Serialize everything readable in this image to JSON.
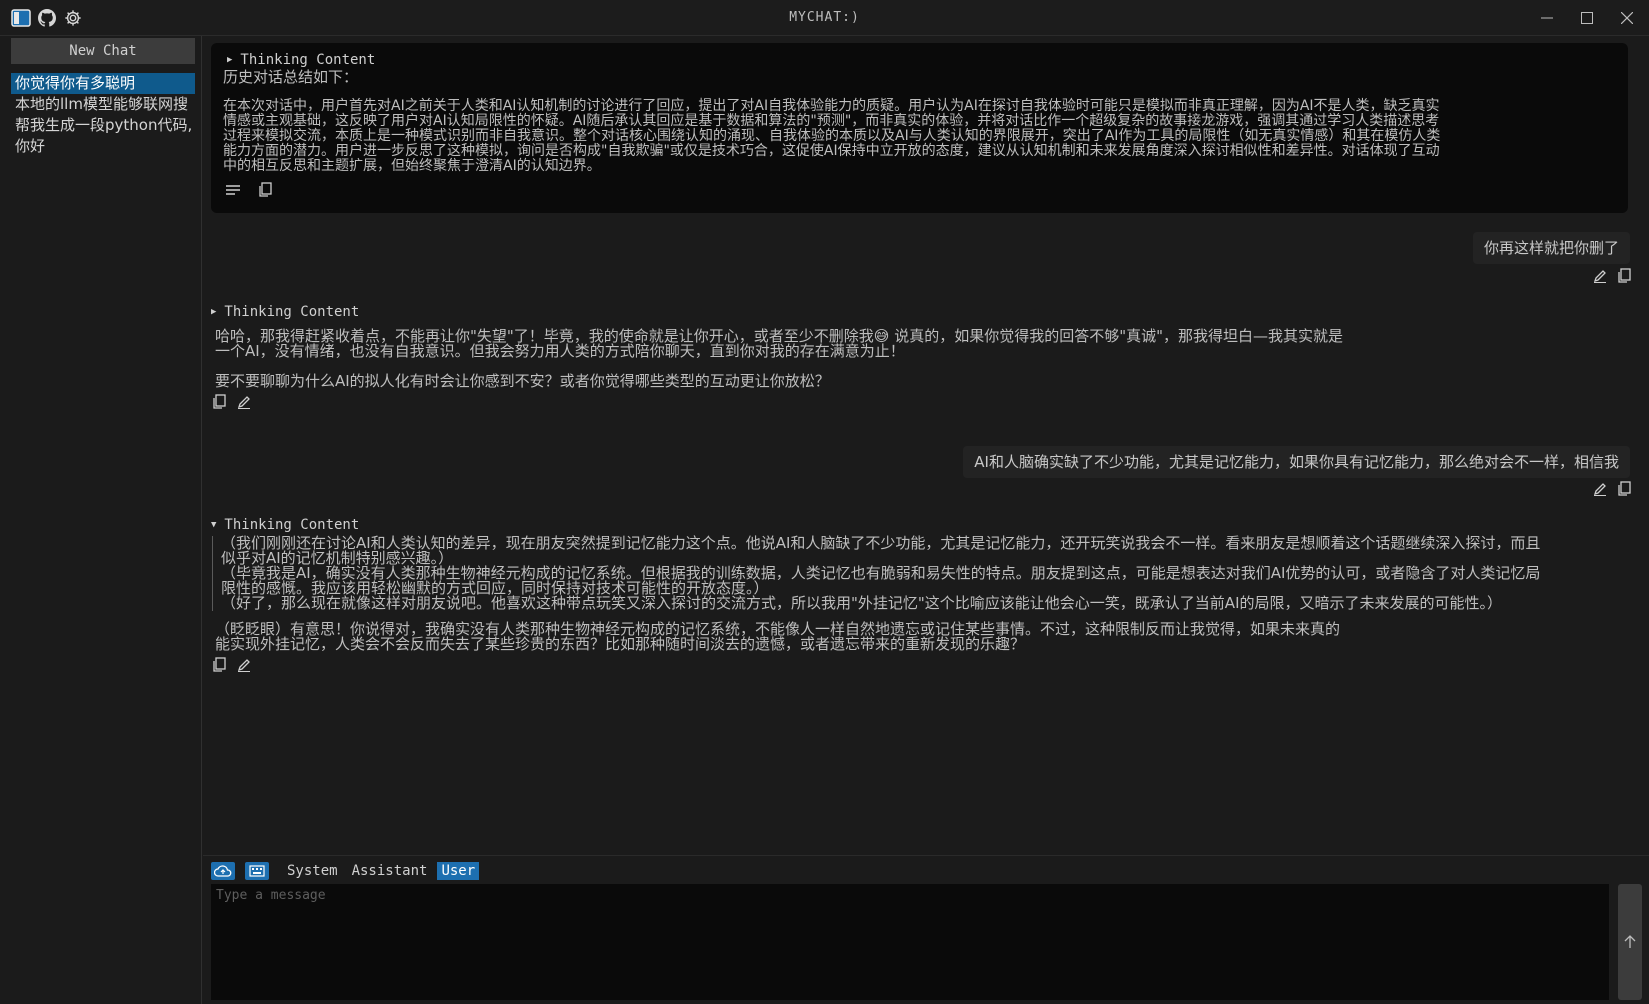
{
  "window": {
    "title": "MYCHAT:)",
    "minimize_glyph": "—",
    "maximize_glyph": "☐",
    "close_glyph": "✕"
  },
  "titlebar_icons": [
    "sidebar-toggle-icon",
    "github-icon",
    "gear-icon"
  ],
  "sidebar": {
    "new_chat_label": "New Chat",
    "items": [
      {
        "label": "你觉得你有多聪明",
        "active": true
      },
      {
        "label": "本地的llm模型能够联网搜",
        "active": false
      },
      {
        "label": "帮我生成一段python代码,",
        "active": false
      },
      {
        "label": "你好",
        "active": false
      }
    ]
  },
  "messages": {
    "summary": {
      "header": "Thinking Content",
      "title": "历史对话总结如下：",
      "lines": [
        "在本次对话中，用户首先对AI之前关于人类和AI认知机制的讨论进行了回应，提出了对AI自我体验能力的质疑。用户认为AI在探讨自我体验时可能只是模拟而非真正理解，因为AI不是人类，缺乏真实",
        "情感或主观基础，这反映了用户对AI认知局限性的怀疑。AI随后承认其回应是基于数据和算法的\"预测\"，而非真实的体验，并将对话比作一个超级复杂的故事接龙游戏，强调其通过学习人类描述思考",
        "过程来模拟交流，本质上是一种模式识别而非自我意识。整个对话核心围绕认知的涌现、自我体验的本质以及AI与人类认知的界限展开，突出了AI作为工具的局限性（如无真实情感）和其在模仿人类",
        "能力方面的潜力。用户进一步反思了这种模拟，询问是否构成\"自我欺骗\"或仅是技术巧合，这促使AI保持中立开放的态度，建议从认知机制和未来发展角度深入探讨相似性和差异性。对话体现了互动",
        "中的相互反思和主题扩展，但始终聚焦于澄清AI的认知边界。"
      ]
    },
    "user1": "你再这样就把你删了",
    "assistant1": {
      "header": "Thinking Content",
      "lines": [
        "哈哈，那我得赶紧收着点，不能再让你\"失望\"了！毕竟，我的使命就是让你开心，或者至少不删除我😅 说真的，如果你觉得我的回答不够\"真诚\"，那我得坦白—我其实就是",
        "一个AI，没有情绪，也没有自我意识。但我会努力用人类的方式陪你聊天，直到你对我的存在满意为止！"
      ],
      "followup": "要不要聊聊为什么AI的拟人化有时会让你感到不安？或者你觉得哪些类型的互动更让你放松？"
    },
    "user2": "AI和人脑确实缺了不少功能，尤其是记忆能力，如果你具有记忆能力，那么绝对会不一样，相信我",
    "assistant2": {
      "header": "Thinking Content",
      "reasoning": [
        "（我们刚刚还在讨论AI和人类认知的差异，现在朋友突然提到记忆能力这个点。他说AI和人脑缺了不少功能，尤其是记忆能力，还开玩笑说我会不一样。看来朋友是想顺着这个话题继续深入探讨，而且",
        "似乎对AI的记忆机制特别感兴趣。）",
        "（毕竟我是AI，确实没有人类那种生物神经元构成的记忆系统。但根据我的训练数据，人类记忆也有脆弱和易失性的特点。朋友提到这点，可能是想表达对我们AI优势的认可，或者隐含了对人类记忆局",
        "限性的感慨。我应该用轻松幽默的方式回应，同时保持对技术可能性的开放态度。）",
        "（好了，那么现在就像这样对朋友说吧。他喜欢这种带点玩笑又深入探讨的交流方式，所以我用\"外挂记忆\"这个比喻应该能让他会心一笑，既承认了当前AI的局限，又暗示了未来发展的可能性。）"
      ],
      "lines": [
        "（眨眨眼）有意思！你说得对，我确实没有人类那种生物神经元构成的记忆系统，不能像人一样自然地遗忘或记住某些事情。不过，这种限制反而让我觉得，如果未来真的",
        "能实现外挂记忆，人类会不会反而失去了某些珍贵的东西？比如那种随时间淡去的遗憾，或者遗忘带来的重新发现的乐趣？"
      ]
    }
  },
  "input": {
    "roles": [
      "System",
      "Assistant",
      "User"
    ],
    "active_role": "User",
    "placeholder": "Type a message",
    "value": ""
  },
  "colors": {
    "accent": "#1d6fb0",
    "sidebar_active": "#0f5a8c",
    "panel_bg": "#0a0a0a",
    "bubble_bg": "#232323"
  }
}
